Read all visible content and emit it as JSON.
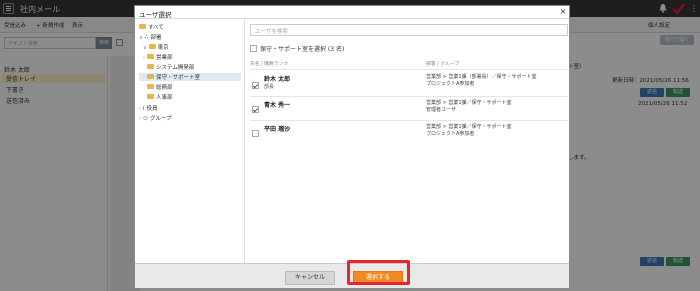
{
  "app": {
    "title": "社内メール",
    "toolbar": {
      "receive": "受信込み",
      "compose": "+ 新規作成",
      "view": "表示",
      "personal": "個人設定"
    },
    "search": {
      "placeholder": "テキスト検索",
      "button": "検索"
    },
    "folders": {
      "owner": "鈴木 太郎",
      "inbox": "受信トレイ",
      "drafts": "下書き",
      "sent": "送信済み"
    },
    "right": {
      "btn": "添付で開く",
      "subject_tail": "ト室）",
      "updated": "更新日時：2021/05/26 11:56",
      "date": "2021/05/26 11:52",
      "body": "します。",
      "reply": "返信",
      "forward": "転送"
    }
  },
  "dialog": {
    "title": "ユーザ選択",
    "close": "×",
    "tree": {
      "all": "すべて",
      "dept": "部署",
      "tokyo": "東京",
      "sales": "営業部",
      "sysdev": "システム開発部",
      "support": "保守・サポート室",
      "general": "総務部",
      "hr": "人事部",
      "roles": "役員",
      "group": "グループ"
    },
    "search_placeholder": "ユーザを検索",
    "select_all": "保守・サポート室を選択 (3 名)",
    "col_name": "氏名 / 職務ランク",
    "col_dept": "部署 / グループ",
    "users": [
      {
        "name": "鈴木 太郎",
        "role": "部長",
        "dept1": "営業部 > 営業1課（部署長）／保守・サポート室",
        "dept2": "プロジェクトA参加者",
        "checked": true
      },
      {
        "name": "青木 秀一",
        "role": "",
        "dept1": "営業部 > 営業1課／保守・サポート室",
        "dept2": "管理者ユーザ",
        "checked": true
      },
      {
        "name": "平田 瑠沙",
        "role": "",
        "dept1": "営業部 > 営業1課／保守・サポート室",
        "dept2": "プロジェクトA参加者",
        "checked": false
      }
    ],
    "cancel": "キャンセル",
    "select": "選択する"
  }
}
